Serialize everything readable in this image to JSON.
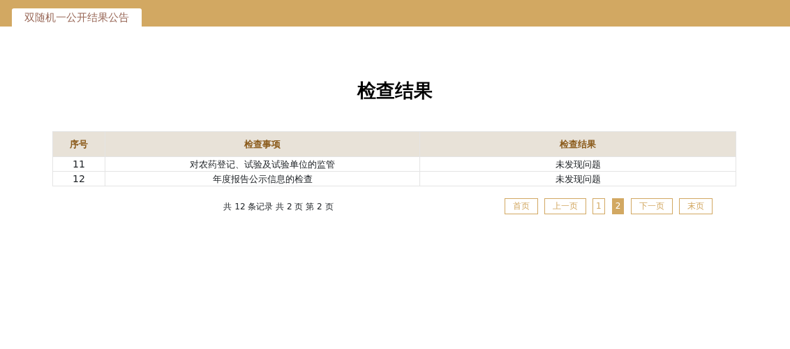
{
  "tabs": [
    {
      "label": "双随机一公开结果公告",
      "selected": true
    }
  ],
  "heading": "检查结果",
  "table": {
    "columns": [
      "序号",
      "检查事项",
      "检查结果"
    ],
    "rows": [
      [
        "11",
        "对农药登记、试验及试验单位的监管",
        "未发现问题"
      ],
      [
        "12",
        "年度报告公示信息的检查",
        "未发现问题"
      ]
    ]
  },
  "pager_summary": "共 12 条记录 共 2 页 第 2 页",
  "pager": [
    {
      "label": "首页",
      "kind": "nav",
      "selected": false
    },
    {
      "label": "上一页",
      "kind": "nav",
      "selected": false
    },
    {
      "label": "1",
      "kind": "page",
      "selected": false
    },
    {
      "label": "2",
      "kind": "page",
      "selected": true
    },
    {
      "label": "下一页",
      "kind": "nav",
      "selected": false
    },
    {
      "label": "末页",
      "kind": "nav",
      "selected": false
    }
  ]
}
